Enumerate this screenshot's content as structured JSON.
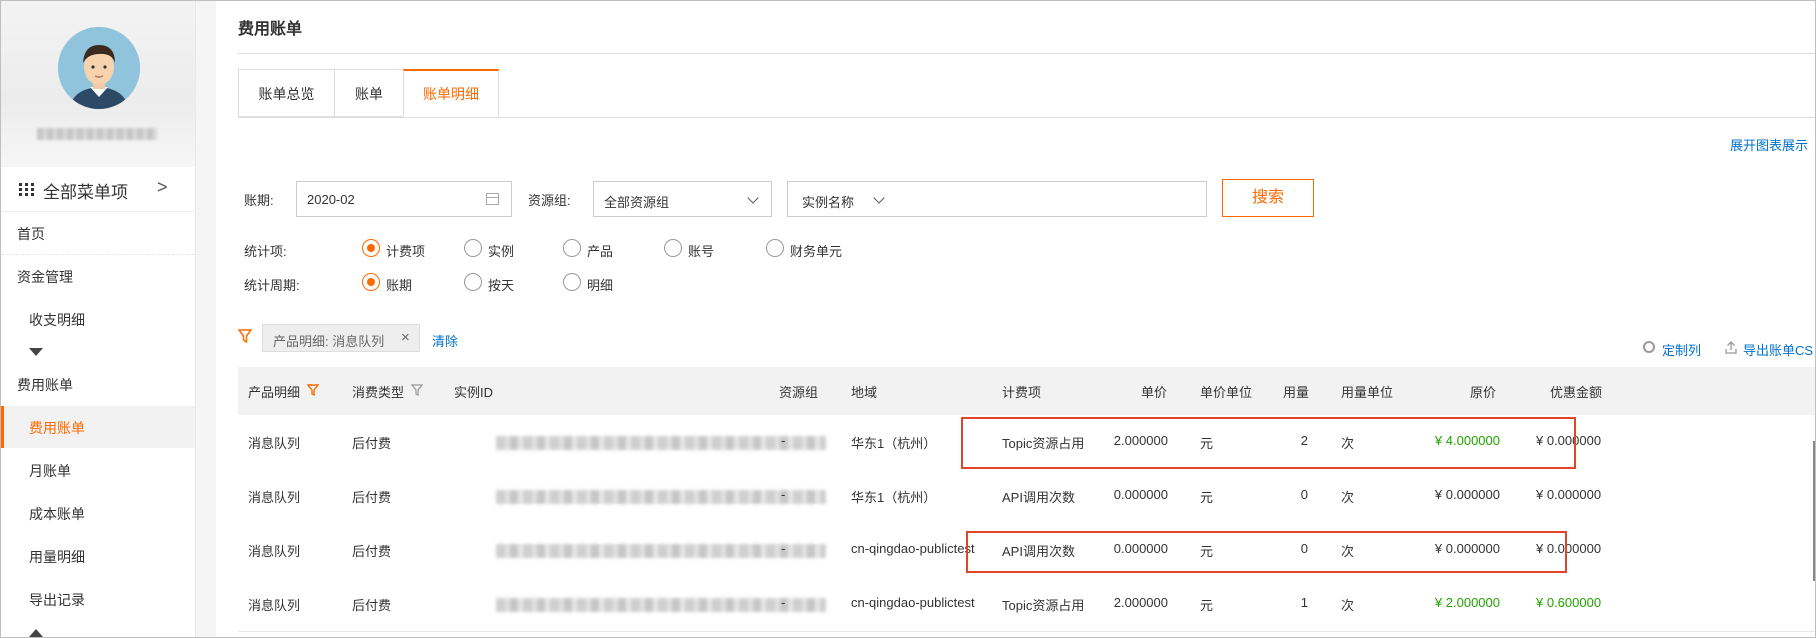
{
  "sidebar": {
    "menu_all_label": "全部菜单项",
    "items": [
      {
        "label": "首页",
        "type": "section"
      },
      {
        "label": "资金管理",
        "type": "section"
      },
      {
        "label": "收支明细",
        "type": "sub"
      },
      {
        "label": "费用账单",
        "type": "section"
      },
      {
        "label": "费用账单",
        "type": "sub",
        "active": true
      },
      {
        "label": "月账单",
        "type": "sub"
      },
      {
        "label": "成本账单",
        "type": "sub"
      },
      {
        "label": "用量明细",
        "type": "sub"
      },
      {
        "label": "导出记录",
        "type": "sub"
      }
    ]
  },
  "page": {
    "title": "费用账单",
    "tabs": [
      {
        "label": "账单总览"
      },
      {
        "label": "账单"
      },
      {
        "label": "账单明细",
        "active": true
      }
    ],
    "expand_link": "展开图表展示"
  },
  "filters": {
    "period_label": "账期:",
    "period_value": "2020-02",
    "resource_group_label": "资源组:",
    "resource_group_value": "全部资源组",
    "instance_select": "实例名称",
    "search_button": "搜索",
    "stat_item_label": "统计项:",
    "stat_item_options": [
      "计费项",
      "实例",
      "产品",
      "账号",
      "财务单元"
    ],
    "stat_item_selected": "计费项",
    "stat_period_label": "统计周期:",
    "stat_period_options": [
      "账期",
      "按天",
      "明细"
    ],
    "stat_period_selected": "账期",
    "active_filter_chip": "产品明细: 消息队列",
    "clear_link": "清除",
    "custom_columns_link": "定制列",
    "export_link": "导出账单CS"
  },
  "table": {
    "headers": [
      "产品明细",
      "消费类型",
      "实例ID",
      "资源组",
      "地域",
      "计费项",
      "单价",
      "单价单位",
      "用量",
      "用量单位",
      "原价",
      "优惠金额"
    ],
    "rows": [
      {
        "product": "消息队列",
        "consume_type": "后付费",
        "resource_group": "-",
        "region": "华东1（杭州）",
        "billing_item": "Topic资源占用",
        "unit_price": "2.000000",
        "price_unit": "元",
        "usage": "2",
        "usage_unit": "次",
        "original_price": "¥ 4.000000",
        "discount": "¥ 0.000000",
        "original_green": true,
        "discount_green": false
      },
      {
        "product": "消息队列",
        "consume_type": "后付费",
        "resource_group": "-",
        "region": "华东1（杭州）",
        "billing_item": "API调用次数",
        "unit_price": "0.000000",
        "price_unit": "元",
        "usage": "0",
        "usage_unit": "次",
        "original_price": "¥ 0.000000",
        "discount": "¥ 0.000000",
        "original_green": false,
        "discount_green": false
      },
      {
        "product": "消息队列",
        "consume_type": "后付费",
        "resource_group": "-",
        "region": "cn-qingdao-publictest",
        "billing_item": "API调用次数",
        "unit_price": "0.000000",
        "price_unit": "元",
        "usage": "0",
        "usage_unit": "次",
        "original_price": "¥ 0.000000",
        "discount": "¥ 0.000000",
        "original_green": false,
        "discount_green": false
      },
      {
        "product": "消息队列",
        "consume_type": "后付费",
        "resource_group": "-",
        "region": "cn-qingdao-publictest",
        "billing_item": "Topic资源占用",
        "unit_price": "2.000000",
        "price_unit": "元",
        "usage": "1",
        "usage_unit": "次",
        "original_price": "¥ 2.000000",
        "discount": "¥ 0.600000",
        "original_green": true,
        "discount_green": true
      }
    ]
  },
  "colors": {
    "accent": "#ff6a00",
    "link": "#0070cc",
    "price_green": "#21a300",
    "highlight": "#e0442b"
  }
}
